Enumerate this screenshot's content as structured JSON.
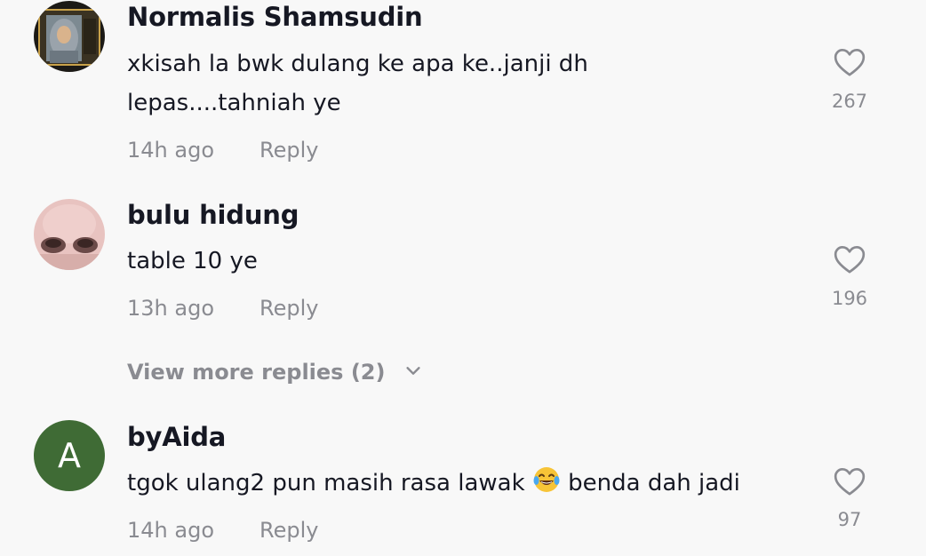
{
  "comments": [
    {
      "username": "Normalis Shamsudin",
      "text_line1": "xkisah la bwk dulang ke apa ke..janji dh",
      "text_line2": "lepas....tahniah ye",
      "time": "14h ago",
      "reply_label": "Reply",
      "likes": "267"
    },
    {
      "username": "bulu hidung",
      "text_line1": "table 10 ye",
      "time": "13h ago",
      "reply_label": "Reply",
      "likes": "196"
    },
    {
      "username": "byAida",
      "avatar_letter": "A",
      "text_before_emoji": "tgok ulang2 pun masih rasa lawak",
      "text_after_emoji": "benda dah jadi",
      "time": "14h ago",
      "reply_label": "Reply",
      "likes": "97"
    }
  ],
  "view_more_replies": "View more replies (2)",
  "icons": {
    "like": "heart-outline-icon",
    "expand": "chevron-down-icon",
    "emoji": "tears-of-joy-emoji"
  },
  "colors": {
    "background": "#f8f8f8",
    "primary_text": "#161823",
    "secondary_text": "#8a8b91",
    "avatar_letter_bg": "#3f6b35"
  }
}
